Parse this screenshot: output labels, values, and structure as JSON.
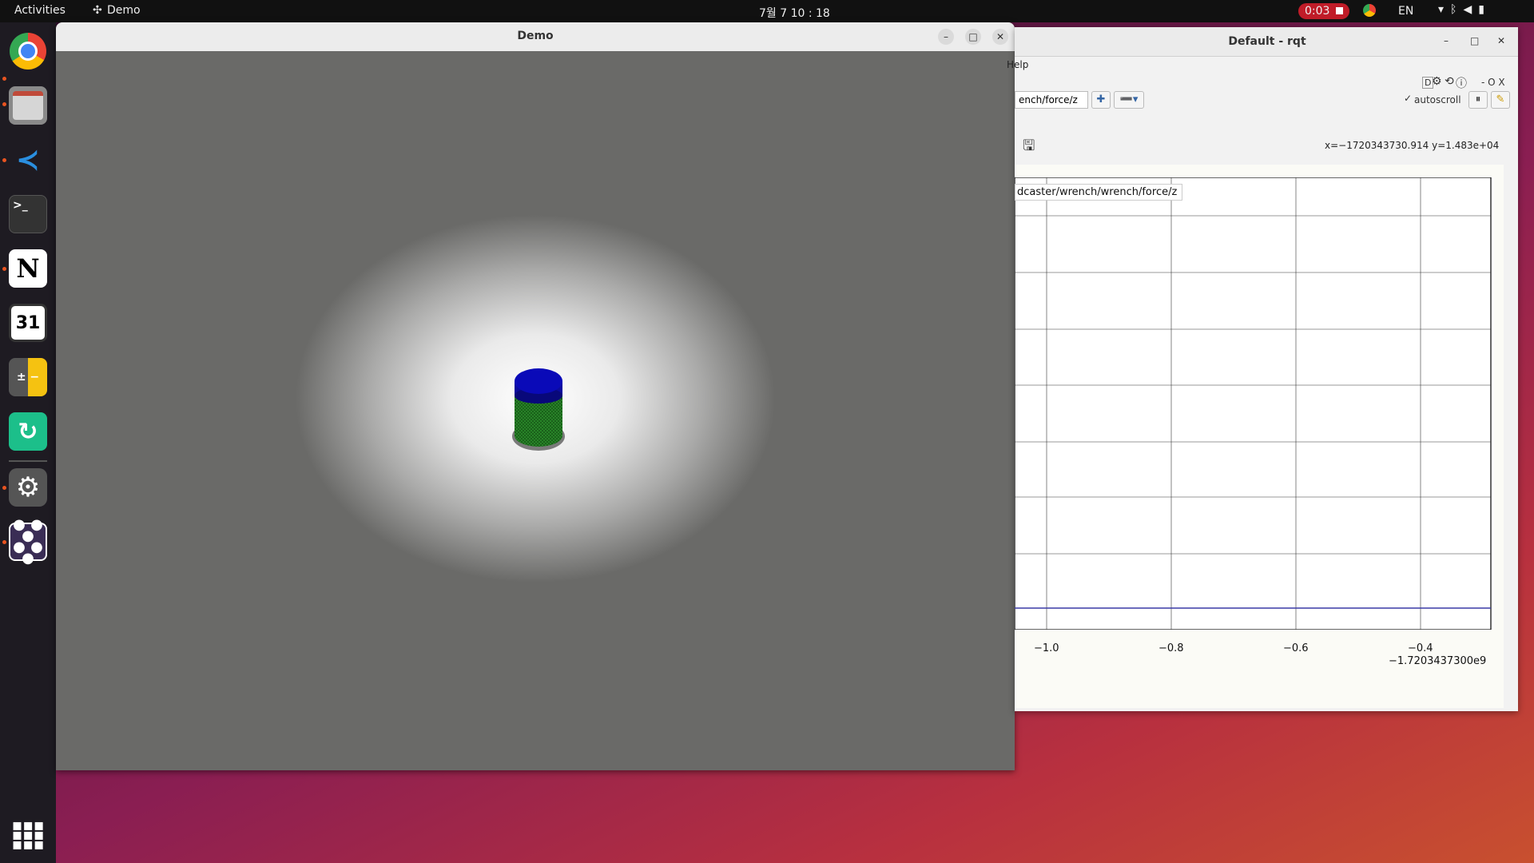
{
  "topbar": {
    "activities": "Activities",
    "app_name": "Demo",
    "clock": "7월 7  10 : 18",
    "recording": "0:03",
    "lang": "EN"
  },
  "dock": {
    "items": [
      "chrome-icon",
      "files-icon",
      "vscode-icon",
      "terminal-icon",
      "notion-icon",
      "calendar-icon",
      "calculator-icon",
      "sync-icon",
      "settings-icon",
      "apps-icon"
    ],
    "calendar_day": "31"
  },
  "demo_window": {
    "title": "Demo"
  },
  "rqt_window": {
    "title": "Default - rqt",
    "menu_help": "Help",
    "topic": "ench/force/z",
    "autoscroll_label": "autoscroll",
    "toolbar_letters": "D",
    "right_controls": "- O X",
    "coordinates": "x=−1720343730.914 y=1.483e+04",
    "legend": "dcaster/wrench/wrench/force/z",
    "x_ticks": [
      "−1.0",
      "−0.8",
      "−0.6",
      "−0.4"
    ],
    "x_offset": "−1.7203437300e9"
  },
  "colors": {
    "series": "#3a3aa6",
    "cylinder_top": "#0a0ab0",
    "cylinder_body": "#1f7a1f"
  }
}
